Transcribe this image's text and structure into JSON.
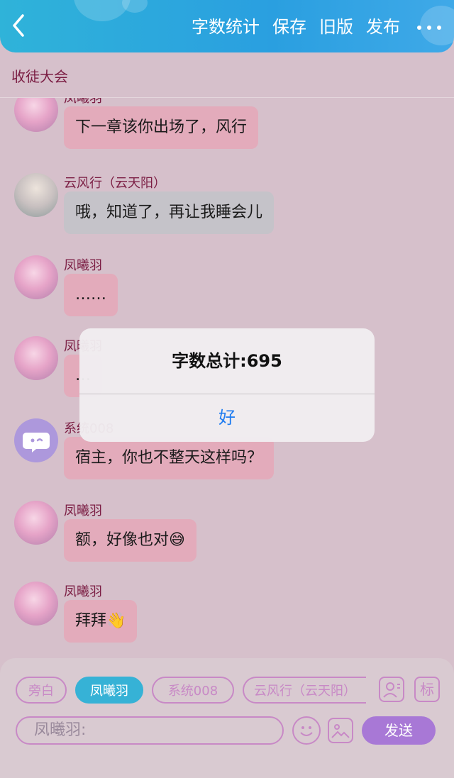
{
  "header": {
    "back_icon": "chevron-left-icon",
    "actions": [
      "字数统计",
      "保存",
      "旧版",
      "发布"
    ],
    "more_icon": "ellipsis-icon"
  },
  "scene": {
    "title": "收徒大会"
  },
  "messages": [
    {
      "name": "凤曦羽",
      "text": "下一章该你出场了，风行",
      "style": "pink"
    },
    {
      "name": "云风行（云天阳）",
      "text": "哦，知道了，再让我睡会儿",
      "style": "grey"
    },
    {
      "name": "凤曦羽",
      "text": "……",
      "style": "pink"
    },
    {
      "name": "凤曦羽",
      "text": "…",
      "style": "pink"
    },
    {
      "name": "系统008",
      "text": "宿主，你也不整天这样吗？",
      "style": "pink"
    },
    {
      "name": "凤曦羽",
      "text": "额，好像也对😅",
      "style": "pink"
    },
    {
      "name": "凤曦羽",
      "text": "拜拜👋",
      "style": "pink"
    }
  ],
  "dialog": {
    "message": "字数总计:695",
    "ok_label": "好"
  },
  "composer": {
    "roles": [
      "旁白",
      "凤曦羽",
      "系统008",
      "云风行（云天阳）"
    ],
    "active_role": "凤曦羽",
    "role_icon": "contact-card-icon",
    "tag_label": "标",
    "input_placeholder": "凤曦羽:",
    "emoji_icon": "smiley-icon",
    "image_icon": "image-icon",
    "send_label": "发送"
  },
  "colors": {
    "header_blue": "#2a9fe0",
    "accent_pink": "#c889c6",
    "send_purple": "#a878d6",
    "dialog_button_blue": "#1f7cf0"
  }
}
